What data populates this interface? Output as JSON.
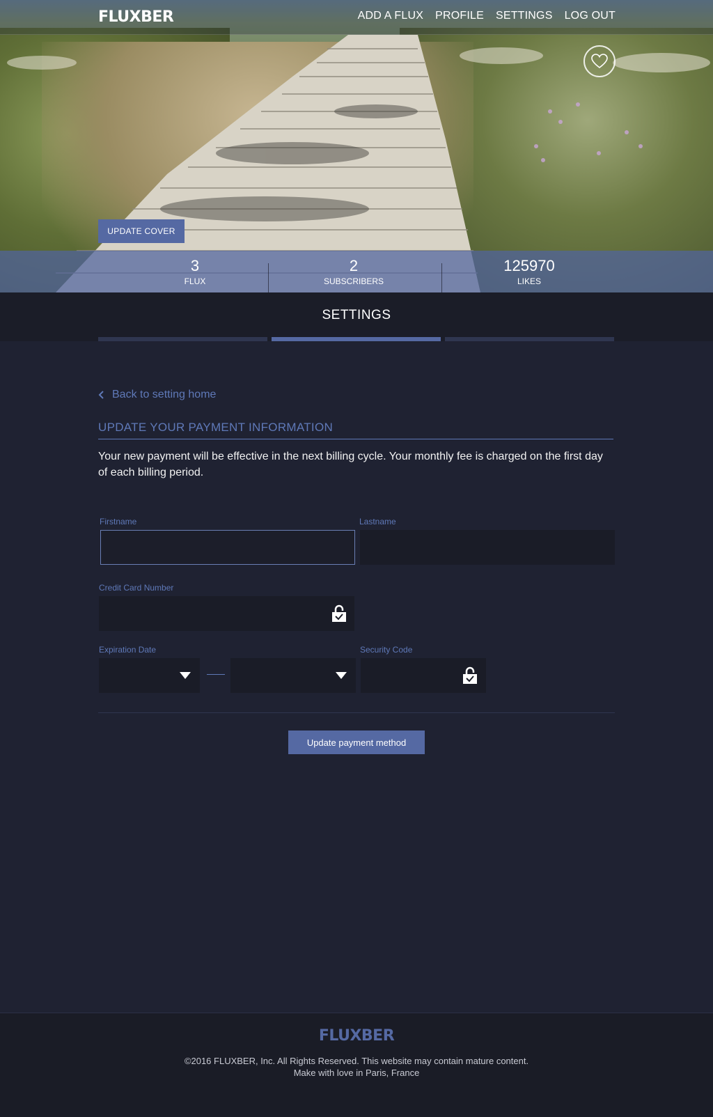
{
  "brand": {
    "logo": "FLUXBER"
  },
  "nav": {
    "items": [
      "ADD A FLUX",
      "PROFILE",
      "SETTINGS",
      "LOG OUT"
    ]
  },
  "hero": {
    "update_cover_label": "UPDATE COVER",
    "favorite_icon": "heart-icon"
  },
  "stats": [
    {
      "value": "3",
      "label": "FLUX"
    },
    {
      "value": "2",
      "label": "SUBSCRIBERS"
    },
    {
      "value": "125970",
      "label": "LIKES"
    }
  ],
  "settings": {
    "title": "SETTINGS",
    "active_tab_index": 1,
    "tab_count": 3
  },
  "content": {
    "back_label": "Back to setting home",
    "section_title": "UPDATE YOUR PAYMENT INFORMATION",
    "description": "Your new payment will be effective in the next billing cycle. Your monthly fee is charged on the first day of each billing period."
  },
  "form": {
    "firstname_label": "Firstname",
    "firstname_value": "",
    "lastname_label": "Lastname",
    "lastname_value": "",
    "card_label": "Credit Card Number",
    "card_value": "",
    "expiration_label": "Expiration Date",
    "expiration_month": "",
    "expiration_year": "",
    "security_label": "Security Code",
    "security_value": "",
    "submit_label": "Update payment method"
  },
  "colors": {
    "accent": "#5569a3",
    "accent_text": "#5f79b8",
    "background": "#1f2232",
    "field": "#1a1c27"
  },
  "footer": {
    "logo": "FLUXBER",
    "copyright": "©2016 FLUXBER, Inc. All Rights Reserved. This website may contain mature content.",
    "tagline": "Make with love in Paris, France"
  }
}
